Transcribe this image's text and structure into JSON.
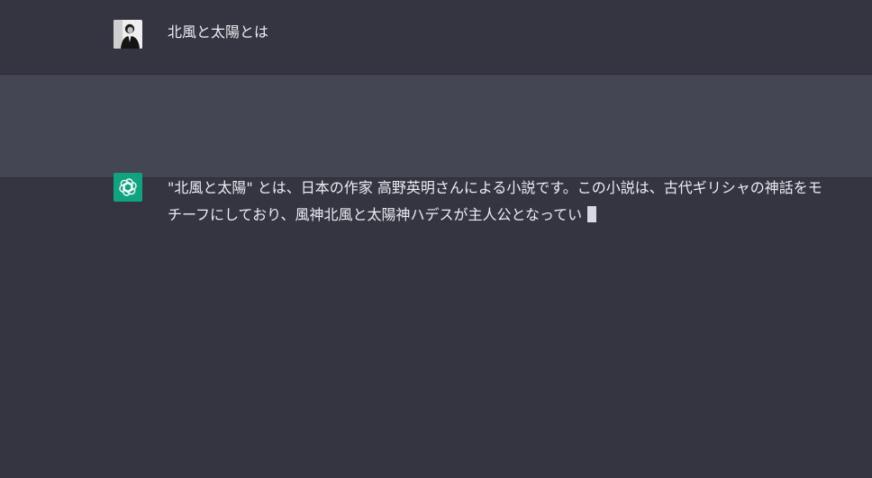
{
  "conversation": {
    "user_message": {
      "avatar_icon": "user-photo-avatar-icon",
      "text": "北風と太陽とは"
    },
    "assistant_message": {
      "avatar_icon": "openai-logo-icon",
      "text": "\"北風と太陽\" とは、日本の作家 高野英明さんによる小説です。この小説は、古代ギリシャの神話をモチーフにしており、風神北風と太陽神ハデスが主人公となってい",
      "streaming": true
    }
  },
  "colors": {
    "background": "#343541",
    "assistant_row": "#444654",
    "text": "#ececf1",
    "bot_avatar": "#10a37f",
    "cursor": "#d9d9e3"
  }
}
